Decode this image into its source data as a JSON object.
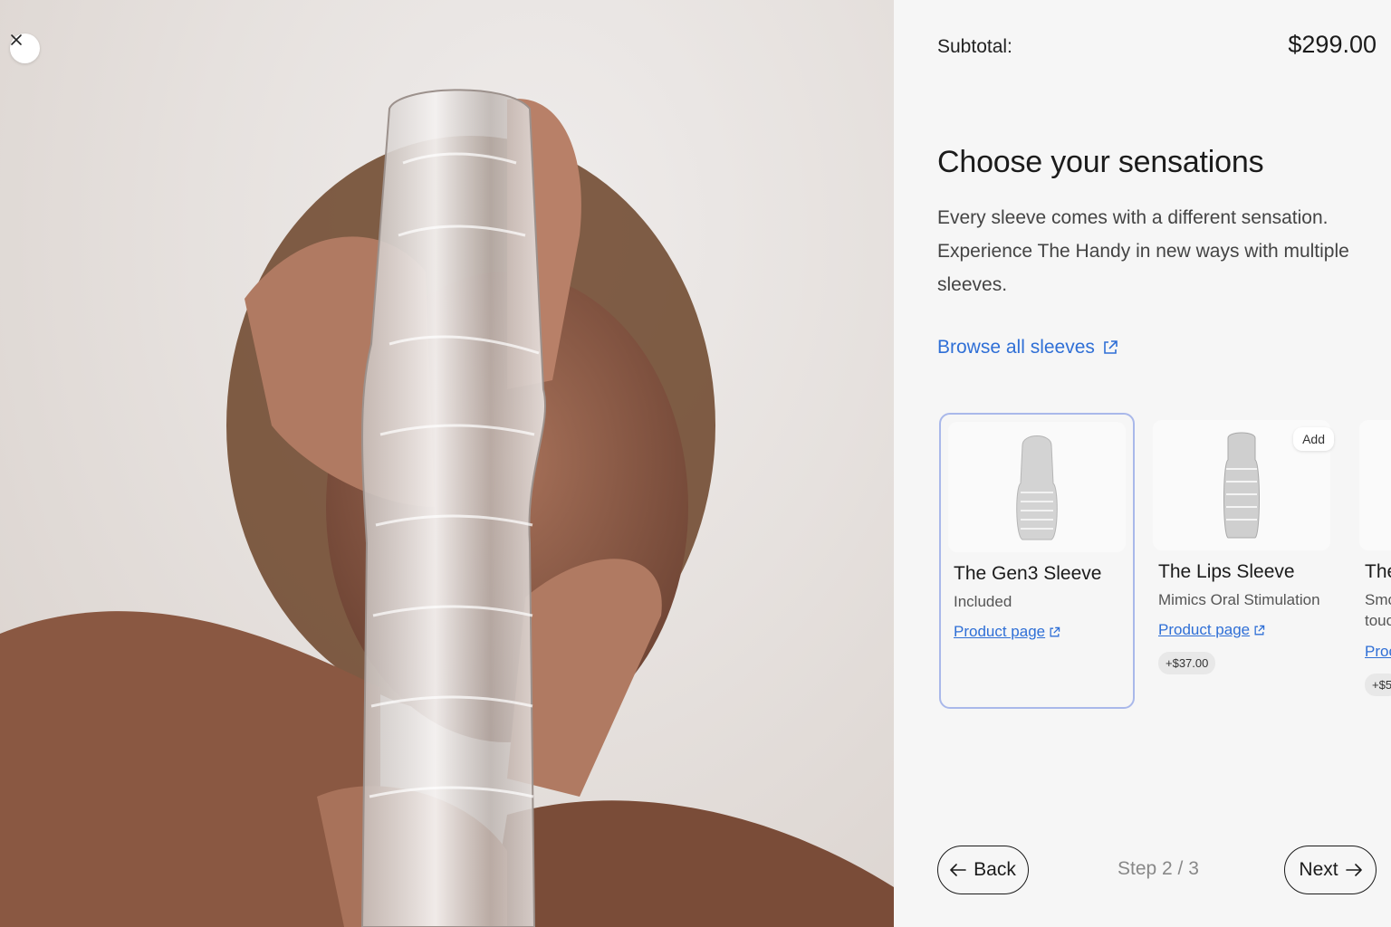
{
  "header": {
    "subtotal_label": "Subtotal:",
    "subtotal_value": "$299.00"
  },
  "main": {
    "title": "Choose your sensations",
    "description": "Every sleeve comes with a different sensation. Experience The Handy in new ways with multiple sleeves.",
    "browse_link": "Browse all sleeves"
  },
  "cards": [
    {
      "name": "The Gen3 Sleeve",
      "subtitle": "Included",
      "link": "Product page",
      "selected": true
    },
    {
      "name": "The Lips Sleeve",
      "subtitle": "Mimics Oral Stimulation",
      "link": "Product page",
      "price": "+$37.00",
      "badge": "Add",
      "selected": false
    },
    {
      "name": "The",
      "subtitle": "Smo",
      "subtitle2": "touc",
      "link": "Proc",
      "price": "+$5",
      "selected": false
    }
  ],
  "footer": {
    "back_label": "Back",
    "step_label": "Step 2 / 3",
    "next_label": "Next"
  },
  "colors": {
    "accent_link": "#2f6fd6",
    "selected_border": "#a9b8ea",
    "panel_bg": "#f6f6f6"
  },
  "icons": {
    "close": "close-icon",
    "external": "external-link-icon",
    "back": "arrow-left-icon",
    "next": "arrow-right-icon"
  }
}
